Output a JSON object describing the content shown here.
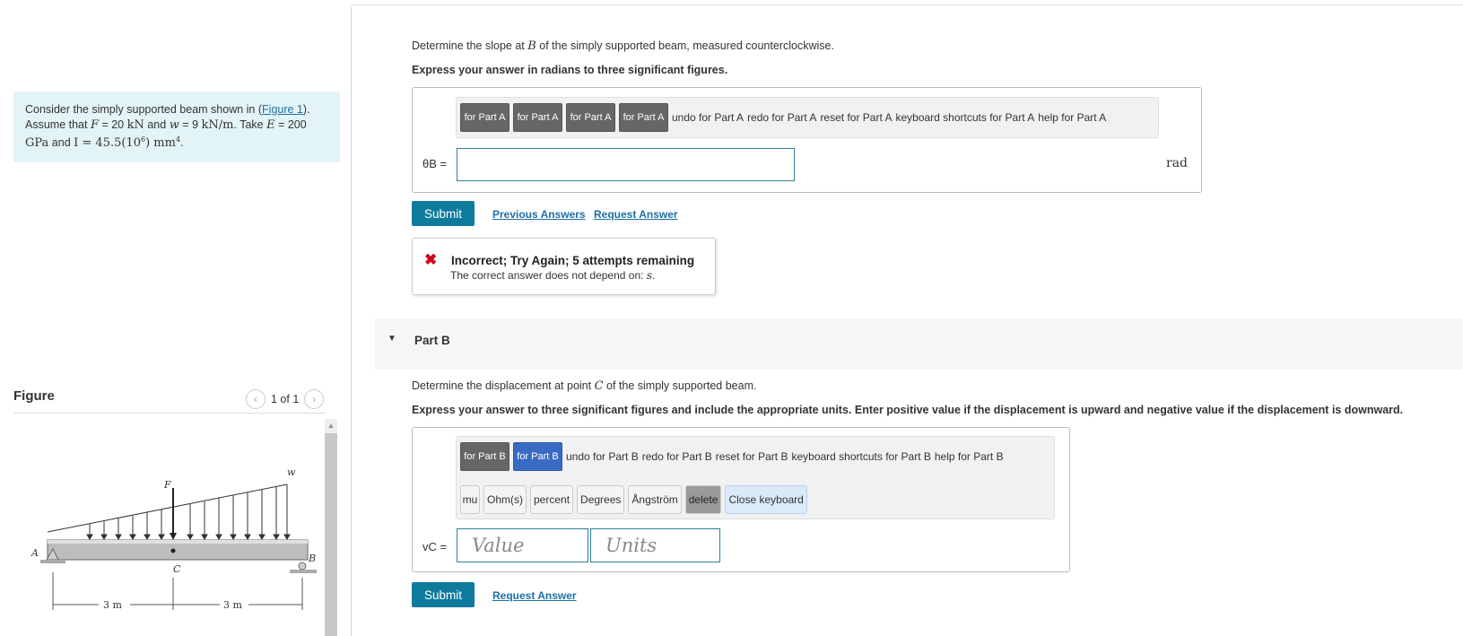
{
  "problem": {
    "text_pre": "Consider the simply supported beam shown in (",
    "figure_link": "Figure 1",
    "text_post": ").",
    "line2_a": "Assume that ",
    "F_sym": "F",
    "F_val": " = 20 ",
    "F_unit": "kN",
    "and": " and ",
    "w_sym": "w",
    "w_val": " = 9 ",
    "w_unit": "kN/m",
    "take": ". Take ",
    "E_sym": "E",
    "E_val": " = 200",
    "line3_a": "GPa",
    "line3_b": " and ",
    "I_expr": "I = 45.5(10",
    "I_exp": "6",
    "I_unit": ") mm",
    "I_unit_exp": "4",
    "line3_end": "."
  },
  "figure": {
    "title": "Figure",
    "page": "1 of 1",
    "labels": {
      "A": "A",
      "B": "B",
      "C": "C",
      "F": "F",
      "w": "w",
      "dim1": "3 m",
      "dim2": "3 m"
    }
  },
  "partA": {
    "question_pre": "Determine the slope at ",
    "question_sym": "B",
    "question_post": " of the simply supported beam, measured counterclockwise.",
    "instruction": "Express your answer in radians to three significant figures.",
    "toolbar": {
      "btn1": "for Part A",
      "btn2": "for Part A",
      "btn3": "for Part A",
      "btn4": "for Part A",
      "btn2_overlay": "vec",
      "undo": "undo for Part A",
      "redo": "redo for Part A",
      "reset": "reset for Part A",
      "keyboard": "keyboard shortcuts for Part A",
      "help": "help for Part A"
    },
    "answer_label": "θB =",
    "answer_value": "",
    "unit": "rad",
    "submit": "Submit",
    "prev_answers": "Previous Answers",
    "request_answer": "Request Answer",
    "feedback": {
      "title": "Incorrect; Try Again; 5 attempts remaining",
      "detail_pre": "The correct answer does not depend on: ",
      "detail_sym": "s",
      "detail_post": "."
    }
  },
  "partB": {
    "header": "Part B",
    "question_pre": "Determine the displacement at point ",
    "question_sym": "C",
    "question_post": " of the simply supported beam.",
    "instruction": "Express your answer to three significant figures and include the appropriate units. Enter positive value if the displacement is upward and negative value if the displacement is downward.",
    "toolbar": {
      "btn1": "for Part B",
      "btn2": "for Part B",
      "undo": "undo for Part B",
      "redo": "redo for Part B",
      "reset": "reset for Part B",
      "keyboard": "keyboard shortcuts for Part B",
      "help": "help for Part B"
    },
    "unit_keys": [
      "mu",
      "Ohm(s)",
      "percent",
      "Degrees",
      "Ångström",
      "delete",
      "Close keyboard"
    ],
    "answer_label": "vC =",
    "value_placeholder": "Value",
    "units_placeholder": "Units",
    "submit": "Submit",
    "request_answer": "Request Answer"
  }
}
